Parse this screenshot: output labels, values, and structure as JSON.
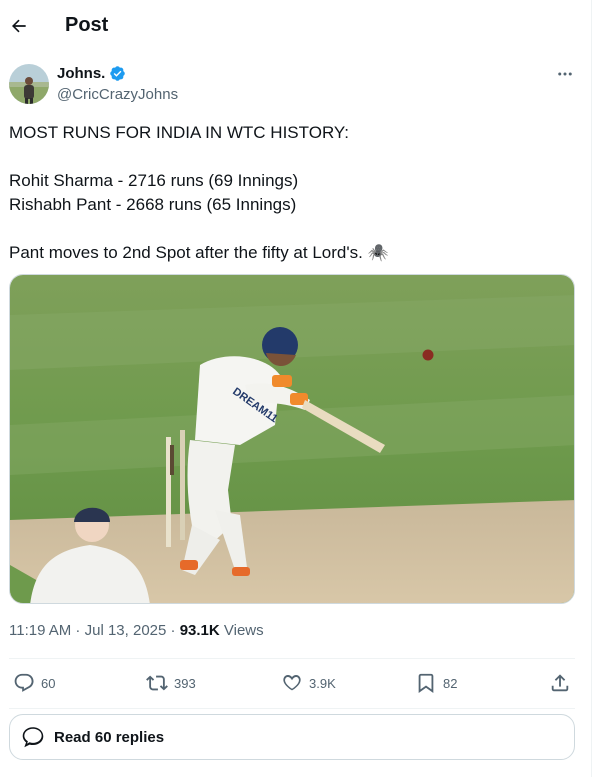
{
  "header": {
    "title": "Post"
  },
  "author": {
    "name": "Johns.",
    "handle": "@CricCrazyJohns"
  },
  "tweet": {
    "lines": [
      "MOST RUNS FOR INDIA IN WTC HISTORY:",
      "Rohit Sharma - 2716 runs (69 Innings)",
      "Rishabh Pant - 2668 runs (65 Innings)",
      "Pant moves to 2nd Spot after the fifty at Lord's. 🕷️"
    ]
  },
  "media": {
    "jersey_text": "DREAM11"
  },
  "meta": {
    "time": "11:19 AM",
    "separator": " · ",
    "date": "Jul 13, 2025",
    "views_count": "93.1K",
    "views_label": " Views"
  },
  "actions": {
    "replies": "60",
    "reposts": "393",
    "likes": "3.9K",
    "bookmarks": "82"
  },
  "read_replies": {
    "label": "Read 60 replies"
  },
  "icons": [
    "back-arrow-icon",
    "verified-badge-icon",
    "more-icon",
    "reply-icon",
    "repost-icon",
    "like-icon",
    "bookmark-icon",
    "share-icon",
    "chat-bubble-icon"
  ],
  "colors": {
    "verified": "#1d9bf0",
    "text": "#0f1419",
    "secondary": "#536471",
    "border": "#cfd9de"
  }
}
